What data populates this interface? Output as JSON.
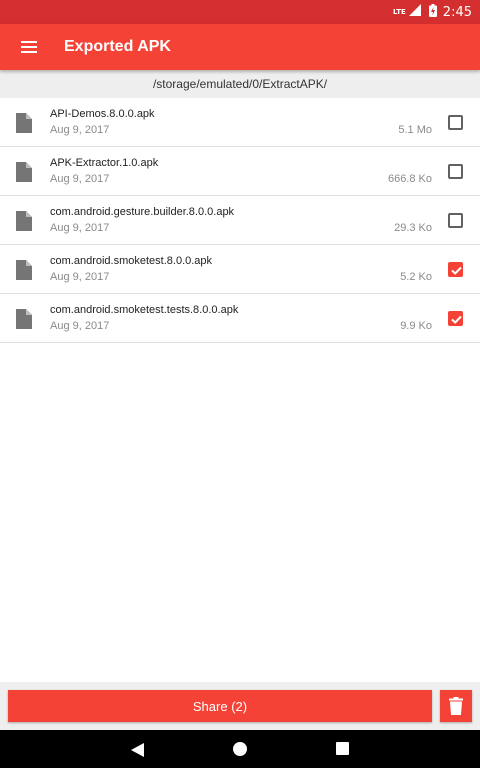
{
  "status_bar": {
    "network": "LTE",
    "time": "2:45",
    "background_color": "#d32f2f"
  },
  "toolbar": {
    "title": "Exported APK",
    "menu_icon": "menu-icon",
    "background_color": "#f44336"
  },
  "path": "/storage/emulated/0/ExtractAPK/",
  "files": [
    {
      "name": "API-Demos.8.0.0.apk",
      "date": "Aug 9, 2017",
      "size": "5.1 Mo",
      "checked": false
    },
    {
      "name": "APK-Extractor.1.0.apk",
      "date": "Aug 9, 2017",
      "size": "666.8 Ko",
      "checked": false
    },
    {
      "name": "com.android.gesture.builder.8.0.0.apk",
      "date": "Aug 9, 2017",
      "size": "29.3 Ko",
      "checked": false
    },
    {
      "name": "com.android.smoketest.8.0.0.apk",
      "date": "Aug 9, 2017",
      "size": "5.2 Ko",
      "checked": true
    },
    {
      "name": "com.android.smoketest.tests.8.0.0.apk",
      "date": "Aug 9, 2017",
      "size": "9.9 Ko",
      "checked": true
    }
  ],
  "bottom_bar": {
    "share_label": "Share (2)",
    "delete_icon": "trash-icon",
    "accent_color": "#f44336"
  },
  "nav_bar": {
    "back_icon": "back-icon",
    "home_icon": "home-icon",
    "recents_icon": "recents-icon"
  }
}
